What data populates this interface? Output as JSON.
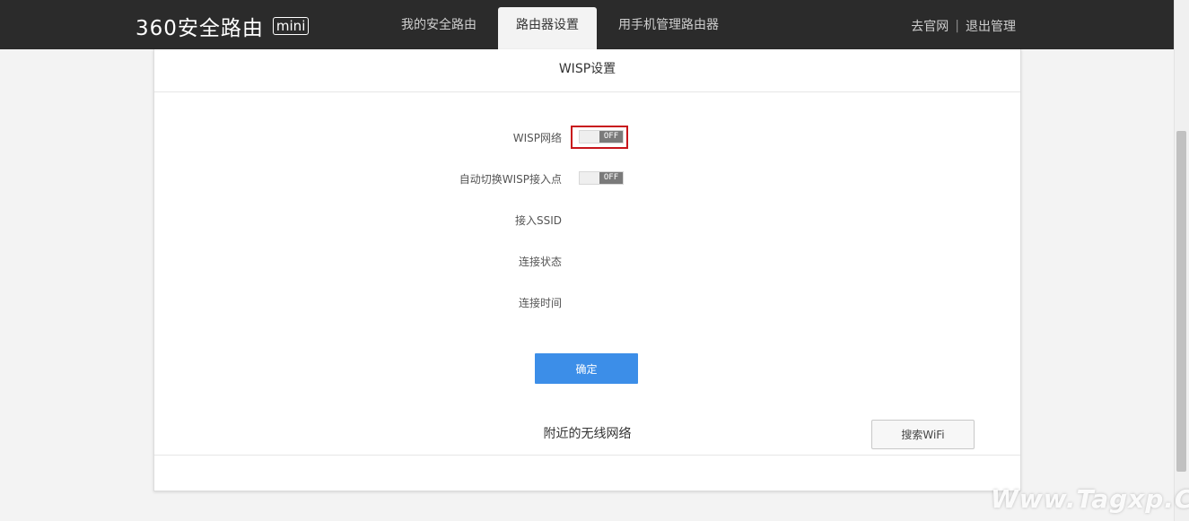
{
  "header": {
    "logo_text": "360安全路由",
    "logo_badge": "mini",
    "tabs": [
      {
        "label": "我的安全路由"
      },
      {
        "label": "路由器设置"
      },
      {
        "label": "用手机管理路由器"
      }
    ],
    "active_tab": "路由器设置",
    "links": {
      "official_site": "去官网",
      "separator": "|",
      "logout": "退出管理"
    },
    "colors": {
      "bar": "#2b2b2b"
    }
  },
  "panel": {
    "title": "WISP设置",
    "fields": [
      {
        "label": "WISP网络",
        "toggle": "OFF"
      },
      {
        "label": "自动切换WISP接入点",
        "toggle": "OFF"
      },
      {
        "label": "接入SSID"
      },
      {
        "label": "连接状态"
      },
      {
        "label": "连接时间"
      }
    ],
    "confirm_label": "确定",
    "nearby_title": "附近的无线网络",
    "search_label": "搜索WiFi",
    "colors": {
      "primary_button": "#3c8ee8",
      "highlight": "#c8151b"
    }
  },
  "watermark": "Www.Tagxp.Com"
}
